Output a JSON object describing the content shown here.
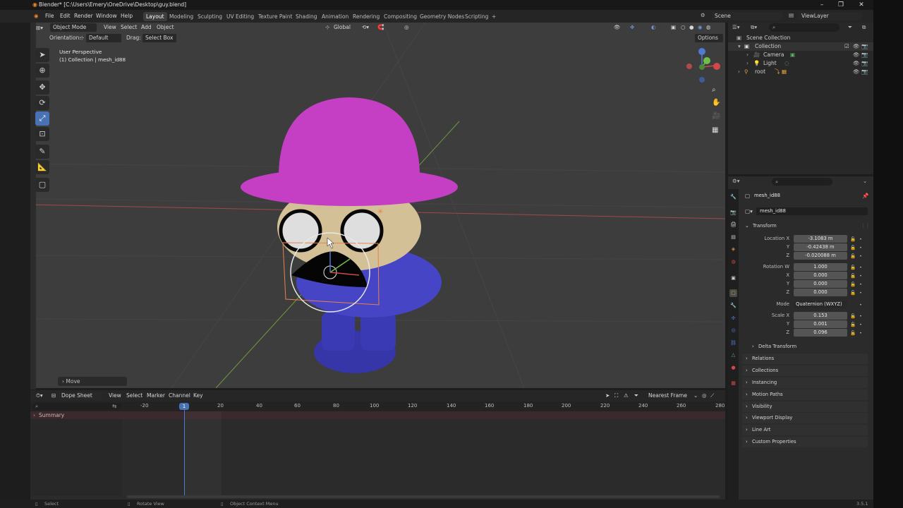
{
  "window": {
    "title": "Blender* [C:\\Users\\Emery\\OneDrive\\Desktop\\guy.blend]"
  },
  "menubar": {
    "menus": [
      "File",
      "Edit",
      "Render",
      "Window",
      "Help"
    ],
    "workspaces": [
      "Layout",
      "Modeling",
      "Sculpting",
      "UV Editing",
      "Texture Paint",
      "Shading",
      "Animation",
      "Rendering",
      "Compositing",
      "Geometry Nodes",
      "Scripting"
    ],
    "active_workspace": "Layout",
    "add_workspace": "+",
    "scene_label": "Scene",
    "view_layer_label": "ViewLayer"
  },
  "viewport": {
    "mode": "Object Mode",
    "menus": [
      "View",
      "Select",
      "Add",
      "Object"
    ],
    "transform_orientation": "Global",
    "orientation_label": "Orientation:",
    "orientation_value": "Default",
    "drag_label": "Drag:",
    "drag_value": "Select Box",
    "options_label": "Options",
    "view_name": "User Perspective",
    "view_info": "(1) Collection | mesh_id88",
    "last_operator": "Move"
  },
  "outliner": {
    "root_label": "Scene Collection",
    "items": [
      {
        "label": "Collection",
        "depth": 1
      },
      {
        "label": "Camera",
        "depth": 2
      },
      {
        "label": "Light",
        "depth": 2
      },
      {
        "label": "root",
        "depth": 1
      }
    ]
  },
  "properties": {
    "object_name": "mesh_id88",
    "data_name": "mesh_id88",
    "transform_panel": "Transform",
    "location": {
      "label": "Location X",
      "x": "-3.1083 m",
      "y": "-0.42438 m",
      "z": "-0.020088 m"
    },
    "rotation": {
      "label": "Rotation W",
      "w": "1.000",
      "x": "0.000",
      "y": "0.000",
      "z": "0.000"
    },
    "mode_label": "Mode",
    "mode_value": "Quaternion (WXYZ)",
    "scale": {
      "label": "Scale X",
      "x": "0.153",
      "y": "0.001",
      "z": "0.096"
    },
    "axis_labels": {
      "y": "Y",
      "z": "Z",
      "x": "X"
    },
    "panels": [
      "Delta Transform",
      "Relations",
      "Collections",
      "Instancing",
      "Motion Paths",
      "Visibility",
      "Viewport Display",
      "Line Art",
      "Custom Properties"
    ]
  },
  "dopesheet": {
    "editor_label": "Dope Sheet",
    "menus": [
      "View",
      "Select",
      "Marker",
      "Channel",
      "Key"
    ],
    "snap_value": "Nearest Frame",
    "current_frame": "1",
    "ticks": [
      "-20",
      "20",
      "40",
      "60",
      "80",
      "100",
      "120",
      "140",
      "160",
      "180",
      "200",
      "220",
      "240",
      "260",
      "280"
    ],
    "summary_label": "Summary"
  },
  "statusbar": {
    "items": [
      "Select",
      "Rotate View",
      "Object Context Menu"
    ],
    "version": "3.5.1"
  },
  "colors": {
    "accent": "#4772b3",
    "hat": "#c43fc4",
    "body": "#4a4ac4",
    "skin": "#d7c39a",
    "selection": "#e6834a"
  }
}
